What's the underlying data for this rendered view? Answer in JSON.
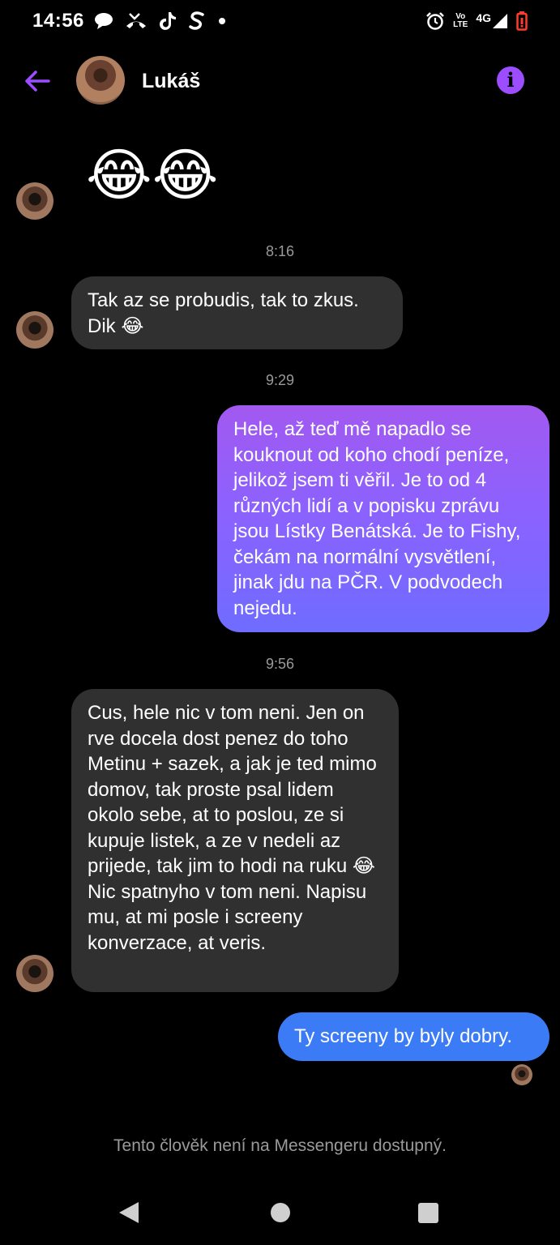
{
  "status_bar": {
    "time": "14:56",
    "left_icons": [
      "chat-bubble-icon",
      "missed-call-icon",
      "tiktok-icon",
      "s-app-icon",
      "dot-icon"
    ],
    "volte_top": "Vo",
    "volte_bottom": "LTE",
    "network": "4G",
    "right_icons": [
      "alarm-icon",
      "volte-icon",
      "signal-icon",
      "battery-low-icon"
    ],
    "battery_color": "#ff3b30"
  },
  "header": {
    "contact_name": "Lukáš",
    "back_icon": "arrow-left-icon",
    "info_icon": "info-icon",
    "info_glyph": "i",
    "accent_color": "#9b4dff"
  },
  "messages": [
    {
      "type": "emoji",
      "from": "them",
      "text": "😂😂"
    },
    {
      "type": "timestamp",
      "text": "8:16"
    },
    {
      "type": "text",
      "from": "them",
      "text": "Tak az se probudis, tak to zkus. Dik 😂"
    },
    {
      "type": "timestamp",
      "text": "9:29"
    },
    {
      "type": "text",
      "from": "me",
      "text": "Hele, až teď mě napadlo se kouknout od koho chodí peníze, jelikož jsem ti věřil. Je to od 4 různých lidí a v popisku zprávu jsou Lístky Benátská. Je to Fishy, čekám na normální vysvětlení, jinak jdu na PČR. V podvodech nejedu."
    },
    {
      "type": "timestamp",
      "text": "9:56"
    },
    {
      "type": "text",
      "from": "them",
      "text": "Cus, hele nic v tom neni. Jen on rve docela dost penez do toho Metinu + sazek, a jak je ted mimo domov, tak proste psal lidem okolo sebe, at to poslou, ze si kupuje listek, a ze v nedeli az prijede, tak jim to hodi na ruku 😂 Nic spatnyho v tom neni. Napisu mu, at mi posle i screeny konverzace, at veris."
    },
    {
      "type": "text",
      "from": "me",
      "text": "Ty screeny by byly dobry."
    }
  ],
  "footer_note": "Tento člověk není na Messengeru dostupný.",
  "nav_bar": {
    "back_icon": "nav-back-icon",
    "home_icon": "nav-home-icon",
    "recents_icon": "nav-recents-icon"
  }
}
